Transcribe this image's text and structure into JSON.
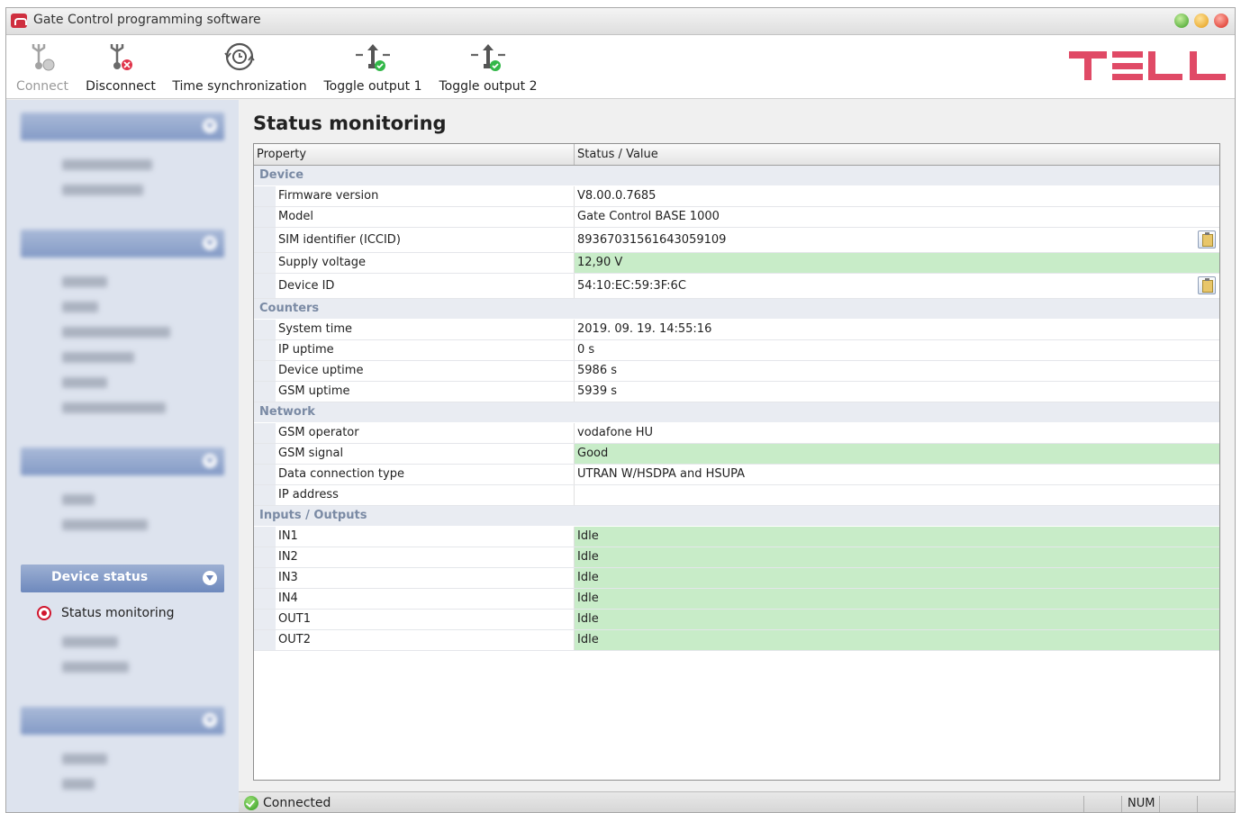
{
  "window": {
    "title": "Gate Control programming software"
  },
  "toolbar": {
    "buttons": [
      {
        "label": "Connect",
        "icon": "usb-connect-icon",
        "enabled": false
      },
      {
        "label": "Disconnect",
        "icon": "usb-disconnect-icon",
        "enabled": true
      },
      {
        "label": "Time synchronization",
        "icon": "clock-sync-icon",
        "enabled": true
      },
      {
        "label": "Toggle output 1",
        "icon": "toggle-output-icon",
        "enabled": true
      },
      {
        "label": "Toggle output 2",
        "icon": "toggle-output-icon",
        "enabled": true
      }
    ],
    "logo": "TELL"
  },
  "sidebar": {
    "active_section": "Device status",
    "active_item": "Status monitoring"
  },
  "main": {
    "title": "Status monitoring",
    "columns": [
      "Property",
      "Status / Value"
    ],
    "groups": [
      {
        "category": "Device",
        "rows": [
          {
            "name": "Firmware version",
            "value": "V8.00.0.7685"
          },
          {
            "name": "Model",
            "value": "Gate Control BASE 1000"
          },
          {
            "name": "SIM identifier (ICCID)",
            "value": "89367031561643059109"
          },
          {
            "name": "Supply voltage",
            "value": "12,90 V"
          },
          {
            "name": "Device ID",
            "value": "54:10:EC:59:3F:6C"
          }
        ]
      },
      {
        "category": "Counters",
        "rows": [
          {
            "name": "System time",
            "value": "2019. 09. 19. 14:55:16"
          },
          {
            "name": "IP uptime",
            "value": "0 s"
          },
          {
            "name": "Device uptime",
            "value": "5986 s"
          },
          {
            "name": "GSM uptime",
            "value": "5939 s"
          }
        ]
      },
      {
        "category": "Network",
        "rows": [
          {
            "name": "GSM operator",
            "value": "vodafone HU"
          },
          {
            "name": "GSM signal",
            "value": "Good"
          },
          {
            "name": "Data connection type",
            "value": "UTRAN W/HSDPA and HSUPA"
          },
          {
            "name": "IP address",
            "value": ""
          }
        ]
      },
      {
        "category": "Inputs / Outputs",
        "rows": [
          {
            "name": "IN1",
            "value": "Idle"
          },
          {
            "name": "IN2",
            "value": "Idle"
          },
          {
            "name": "IN3",
            "value": "Idle"
          },
          {
            "name": "IN4",
            "value": "Idle"
          },
          {
            "name": "OUT1",
            "value": "Idle"
          },
          {
            "name": "OUT2",
            "value": "Idle"
          }
        ]
      }
    ]
  },
  "statusbar": {
    "connection": "Connected",
    "num_indicator": "NUM"
  },
  "colors": {
    "ok_background": "#c8ecc8",
    "section_header": "#7a92c2",
    "logo": "#e04a66",
    "active_radio": "#d0152d"
  }
}
